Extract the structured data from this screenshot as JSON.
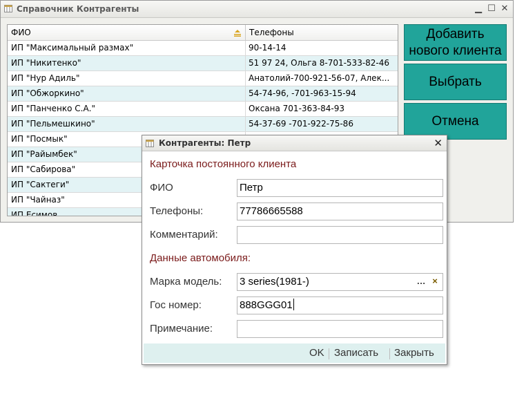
{
  "main_window": {
    "title": "Справочник Контрагенты",
    "columns": [
      "ФИО",
      "Телефоны"
    ],
    "rows": [
      {
        "name": "ИП \"Максимальный размах\"",
        "phones": "90-14-14"
      },
      {
        "name": "ИП \"Никитенко\"",
        "phones": "51 97 24, Ольга 8-701-533-82-46"
      },
      {
        "name": "ИП \"Нур Адиль\"",
        "phones": "Анатолий-700-921-56-07, Алек..."
      },
      {
        "name": "ИП \"Обжоркино\"",
        "phones": "54-74-96, -701-963-15-94"
      },
      {
        "name": "ИП \"Панченко С.А.\"",
        "phones": "Оксана 701-363-84-93"
      },
      {
        "name": "ИП \"Пельмешкино\"",
        "phones": "54-37-69 -701-922-75-86"
      },
      {
        "name": "ИП \"Посмык\"",
        "phones": ""
      },
      {
        "name": "ИП \"Райымбек\"",
        "phones": ""
      },
      {
        "name": "ИП \"Сабирова\"",
        "phones": ""
      },
      {
        "name": "ИП \"Сактеги\"",
        "phones": ""
      },
      {
        "name": "ИП \"Чайназ\"",
        "phones": ""
      },
      {
        "name": "ИП Есимов",
        "phones": ""
      }
    ],
    "buttons": {
      "add_line1": "Добавить",
      "add_line2": "нового клиента",
      "select": "Выбрать",
      "cancel": "Отмена"
    }
  },
  "dialog": {
    "title": "Контрагенты: Петр",
    "section_client": "Карточка постоянного клиента",
    "label_fio": "ФИО",
    "value_fio": "Петр",
    "label_phones": "Телефоны:",
    "value_phones": "77786665588",
    "label_comment": "Комментарий:",
    "value_comment": "",
    "section_car": "Данные автомобиля:",
    "label_model": "Марка модель:",
    "value_model": "3 series(1981-)",
    "label_plate": "Гос номер:",
    "value_plate": "888GGG01",
    "label_note": "Примечание:",
    "value_note": "",
    "btn_ok": "OK",
    "btn_save": "Записать",
    "btn_close": "Закрыть",
    "accent_color": "#21a49a",
    "section_color": "#7a1a1a"
  }
}
